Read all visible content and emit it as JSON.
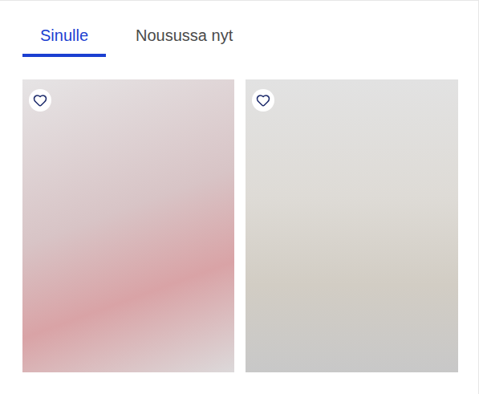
{
  "tabs": [
    {
      "label": "Sinulle",
      "selected": true
    },
    {
      "label": "Nousussa nyt",
      "selected": false
    }
  ],
  "cards": [
    {
      "favorited": false
    },
    {
      "favorited": false
    }
  ]
}
